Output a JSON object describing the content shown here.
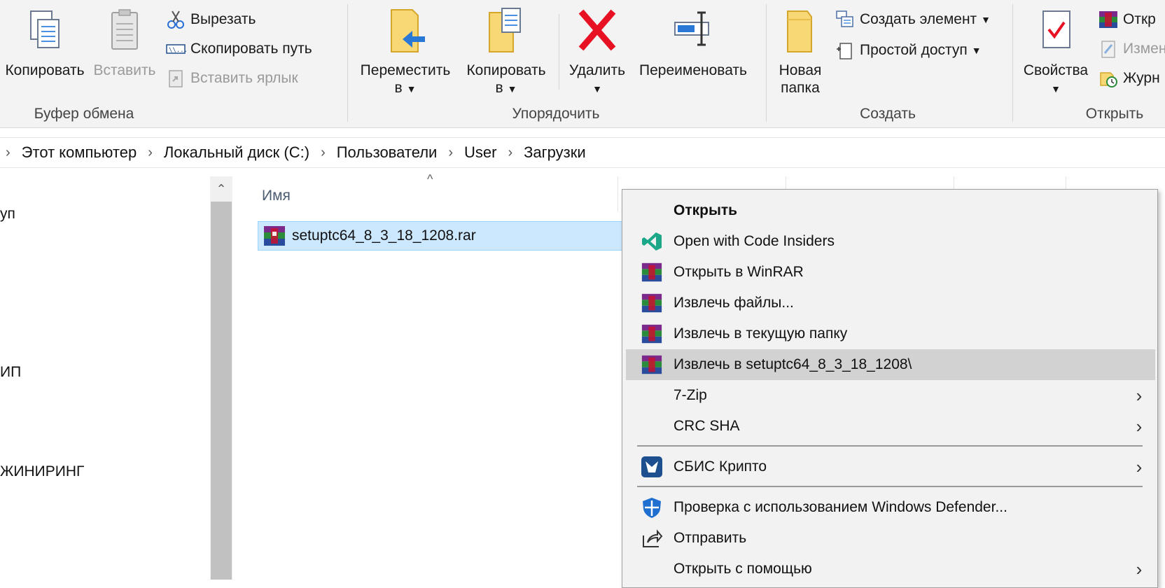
{
  "ribbon": {
    "clipboard": {
      "copy": "Копировать",
      "paste": "Вставить",
      "cut": "Вырезать",
      "copy_path": "Скопировать путь",
      "paste_shortcut": "Вставить ярлык",
      "label": "Буфер обмена"
    },
    "organize": {
      "move_to": "Переместить",
      "move_to_sub": "в",
      "copy_to": "Копировать",
      "copy_to_sub": "в",
      "delete": "Удалить",
      "rename": "Переименовать",
      "label": "Упорядочить"
    },
    "new": {
      "new_folder_1": "Новая",
      "new_folder_2": "папка",
      "new_item": "Создать элемент",
      "easy_access": "Простой доступ",
      "label": "Создать"
    },
    "open": {
      "properties": "Свойства",
      "open": "Откр",
      "edit": "Измен",
      "history": "Журн",
      "label": "Открыть"
    }
  },
  "breadcrumb": [
    "Этот компьютер",
    "Локальный диск (C:)",
    "Пользователи",
    "User",
    "Загрузки"
  ],
  "nav_pane": {
    "items": [
      "уп",
      "ИП",
      "ЖИНИРИНГ"
    ]
  },
  "files": {
    "column_name": "Имя",
    "selected_file": "setuptc64_8_3_18_1208.rar"
  },
  "context_menu": {
    "items": [
      {
        "label": "Открыть",
        "icon": "none",
        "bold": true
      },
      {
        "label": "Open with Code Insiders",
        "icon": "vscode-insiders-icon"
      },
      {
        "label": "Открыть в WinRAR",
        "icon": "winrar-icon"
      },
      {
        "label": "Извлечь файлы...",
        "icon": "winrar-icon"
      },
      {
        "label": "Извлечь в текущую папку",
        "icon": "winrar-icon"
      },
      {
        "label": "Извлечь в setuptc64_8_3_18_1208\\",
        "icon": "winrar-icon",
        "highlighted": true
      },
      {
        "label": "7-Zip",
        "icon": "none",
        "submenu": true
      },
      {
        "label": "CRC SHA",
        "icon": "none",
        "submenu": true
      },
      {
        "label": "СБИС Крипто",
        "icon": "sbis-icon",
        "submenu": true
      },
      {
        "label": "Проверка с использованием Windows Defender...",
        "icon": "defender-icon"
      },
      {
        "label": "Отправить",
        "icon": "share-icon"
      },
      {
        "label": "Открыть с помощью",
        "icon": "none",
        "submenu": true
      }
    ]
  },
  "colors": {
    "ribbon_bg": "#f3f3f3",
    "selection_bg": "#cce8ff",
    "menu_bg": "#f2f2f2",
    "menu_hover": "#d2d2d2",
    "delete_red": "#e81123",
    "folder_yellow": "#f8d775"
  }
}
